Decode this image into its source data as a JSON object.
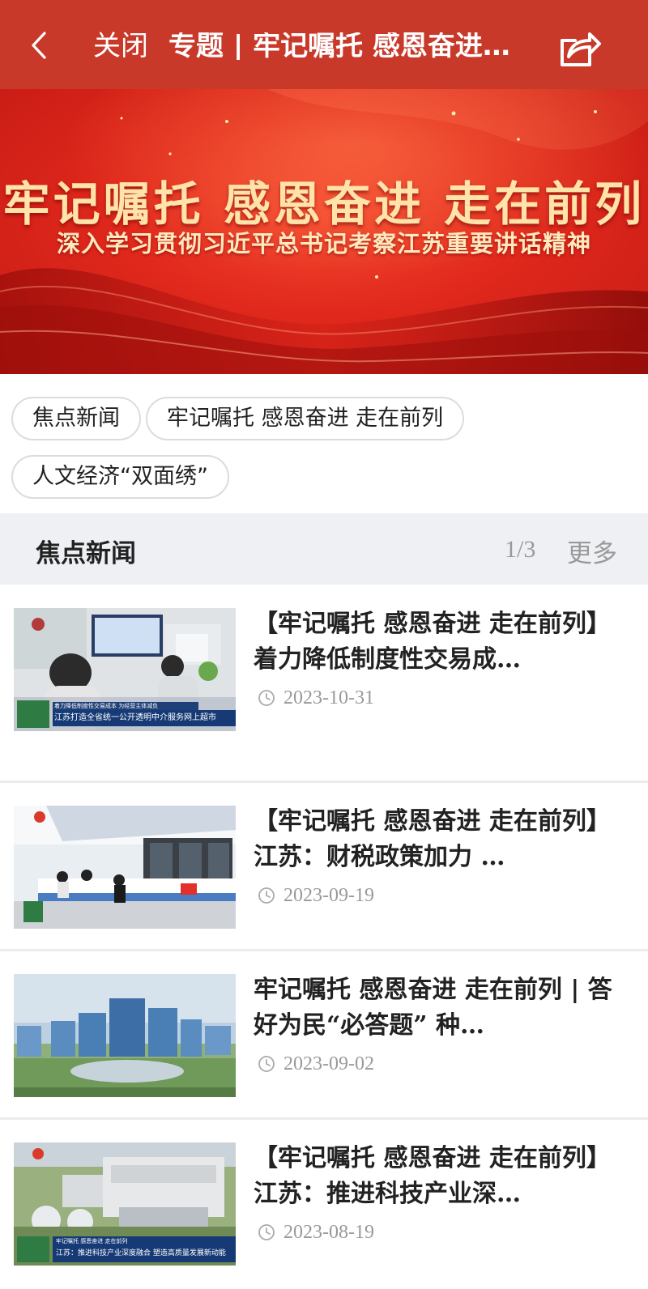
{
  "nav": {
    "close_label": "关闭",
    "title": "专题 | 牢记嘱托 感恩奋进…"
  },
  "banner": {
    "title": "牢记嘱托 感恩奋进 走在前列",
    "subtitle": "深入学习贯彻习近平总书记考察江苏重要讲话精神"
  },
  "tags": [
    "焦点新闻",
    "牢记嘱托 感恩奋进 走在前列",
    "人文经济“双面绣”"
  ],
  "section": {
    "title": "焦点新闻",
    "page": "1/3",
    "more_label": "更多"
  },
  "news": [
    {
      "headline": "【牢记嘱托 感恩奋进 走在前列】着力降低制度性交易成…",
      "date": "2023-10-31",
      "thumb_caption_top": "着力降低制度性交易成本 为经营主体减负",
      "thumb_caption": "江苏打造全省统一公开透明中介服务网上超市"
    },
    {
      "headline": "【牢记嘱托 感恩奋进 走在前列】江苏：财税政策加力 …",
      "date": "2023-09-19"
    },
    {
      "headline": "牢记嘱托 感恩奋进 走在前列 | 答好为民“必答题” 种…",
      "date": "2023-09-02"
    },
    {
      "headline": "【牢记嘱托 感恩奋进 走在前列】江苏：推进科技产业深…",
      "date": "2023-08-19",
      "thumb_caption_top": "牢记嘱托 感恩奋进 走在前列",
      "thumb_caption": "江苏：推进科技产业深度融合 塑造高质量发展新动能"
    }
  ],
  "colors": {
    "nav_bg": "#c8392a",
    "banner_red": "#e0281c",
    "section_bg": "#eef0f4",
    "muted": "#999999"
  },
  "icons": [
    "back-icon",
    "share-icon",
    "clock-icon"
  ]
}
